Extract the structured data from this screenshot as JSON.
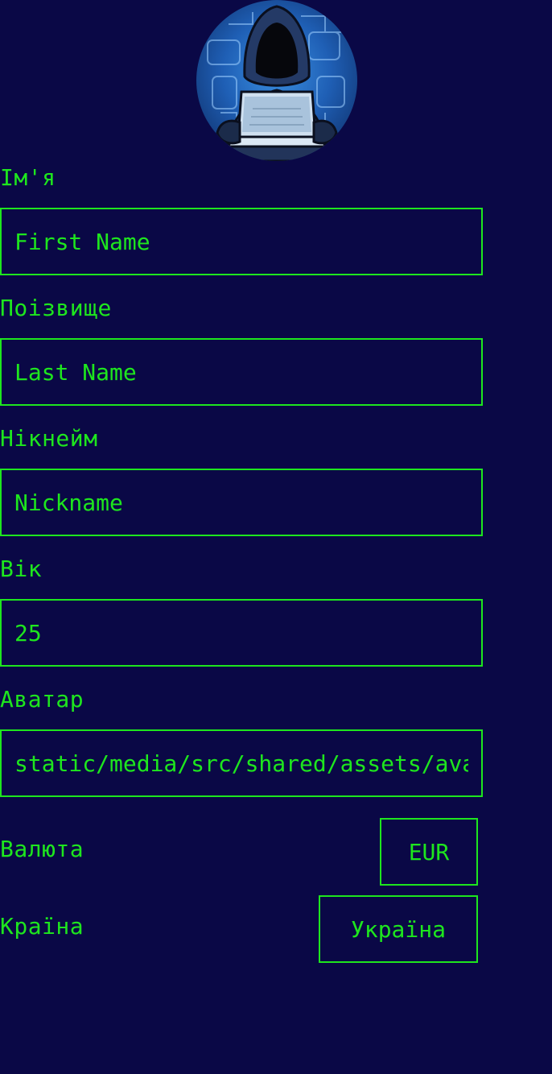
{
  "avatar": {
    "icon": "hacker-avatar-image"
  },
  "form": {
    "first_name": {
      "label": "Ім'я",
      "placeholder": "First Name",
      "value": ""
    },
    "last_name": {
      "label": "Поізвище",
      "placeholder": "Last Name",
      "value": ""
    },
    "nickname": {
      "label": "Нікнейм",
      "placeholder": "Nickname",
      "value": ""
    },
    "age": {
      "label": "Вік",
      "placeholder": "",
      "value": "25"
    },
    "avatar_path": {
      "label": "Аватар",
      "placeholder": "",
      "value": "static/media/src/shared/assets/avatar.png"
    },
    "currency": {
      "label": "Валюта",
      "selected": "EUR"
    },
    "country": {
      "label": "Країна",
      "selected": "Україна"
    }
  },
  "colors": {
    "background": "#0a0846",
    "accent": "#1ee61e"
  }
}
